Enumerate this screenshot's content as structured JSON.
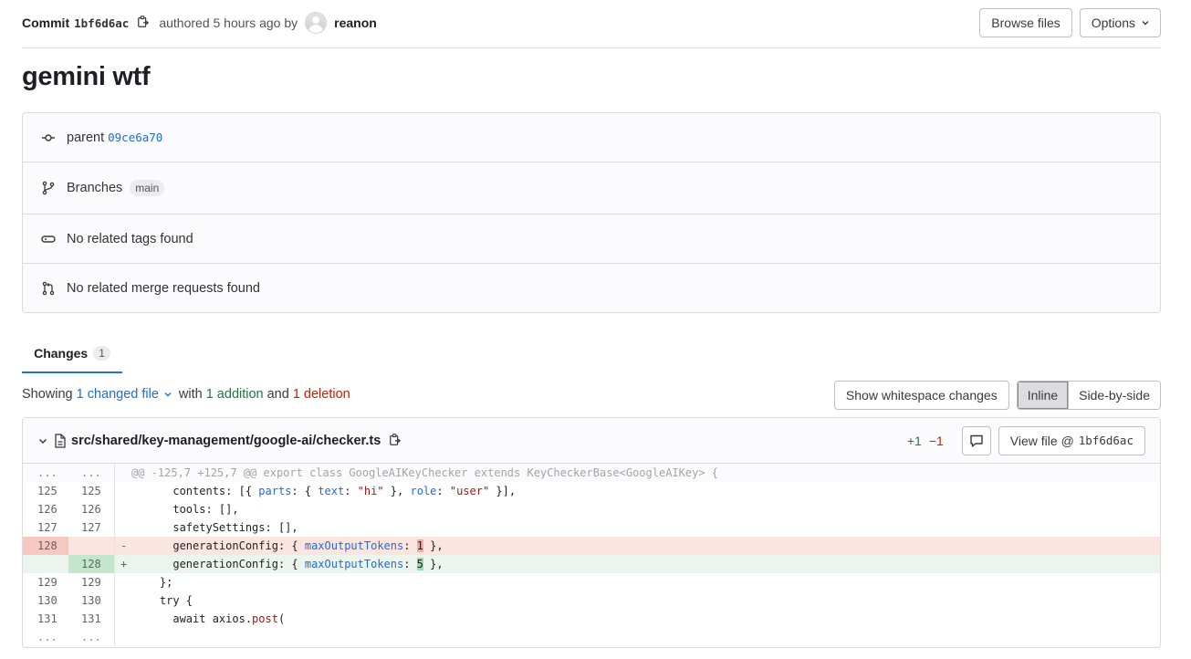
{
  "header": {
    "commit_label": "Commit",
    "sha": "1bf6d6ac",
    "authored_text": "authored 5 hours ago by",
    "author": "reanon",
    "browse_files": "Browse files",
    "options": "Options"
  },
  "title": "gemini wtf",
  "info": {
    "parent_label": "parent",
    "parent_sha": "09ce6a70",
    "branches_label": "Branches",
    "branch": "main",
    "tags_text": "No related tags found",
    "mr_text": "No related merge requests found"
  },
  "tabs": {
    "changes_label": "Changes",
    "changes_count": "1"
  },
  "showing": {
    "prefix": "Showing",
    "changed_files": "1 changed file",
    "with": "with",
    "additions": "1 addition",
    "and": "and",
    "deletions": "1 deletion",
    "whitespace_button": "Show whitespace changes",
    "inline": "Inline",
    "side_by_side": "Side-by-side"
  },
  "file": {
    "path": "src/shared/key-management/google-ai/checker.ts",
    "additions": "+1",
    "deletions": "−1",
    "view_file": "View file @",
    "view_file_sha": "1bf6d6ac"
  },
  "diff": {
    "hunk_header": "@@ -125,7 +125,7 @@ export class GoogleAIKeyChecker extends KeyCheckerBase<GoogleAIKey> {",
    "ellipsis": "...",
    "lines": [
      {
        "old": "125",
        "new": "125"
      },
      {
        "old": "126",
        "new": "126"
      },
      {
        "old": "127",
        "new": "127"
      },
      {
        "old": "128",
        "new": ""
      },
      {
        "old": "",
        "new": "128"
      },
      {
        "old": "129",
        "new": "129"
      },
      {
        "old": "130",
        "new": "130"
      },
      {
        "old": "131",
        "new": "131"
      }
    ],
    "marker_removed": "-",
    "marker_added": "+",
    "code": {
      "l125_a": "      contents: [{ ",
      "l125_b": "parts",
      "l125_c": ": { ",
      "l125_d": "text",
      "l125_e": ": ",
      "l125_f": "\"hi\"",
      "l125_g": " }, ",
      "l125_h": "role",
      "l125_i": ": ",
      "l125_j": "\"user\"",
      "l125_k": " }],",
      "l126": "      tools: [],",
      "l127": "      safetySettings: [],",
      "l128_pre": "      generationConfig: { ",
      "l128_key": "maxOutputTokens",
      "l128_colon": ": ",
      "l128_old_val": "1",
      "l128_new_val": "5",
      "l128_post": " },",
      "l129": "    };",
      "l130": "    try {",
      "l131_a": "      await axios.",
      "l131_b": "post",
      "l131_c": "("
    }
  }
}
